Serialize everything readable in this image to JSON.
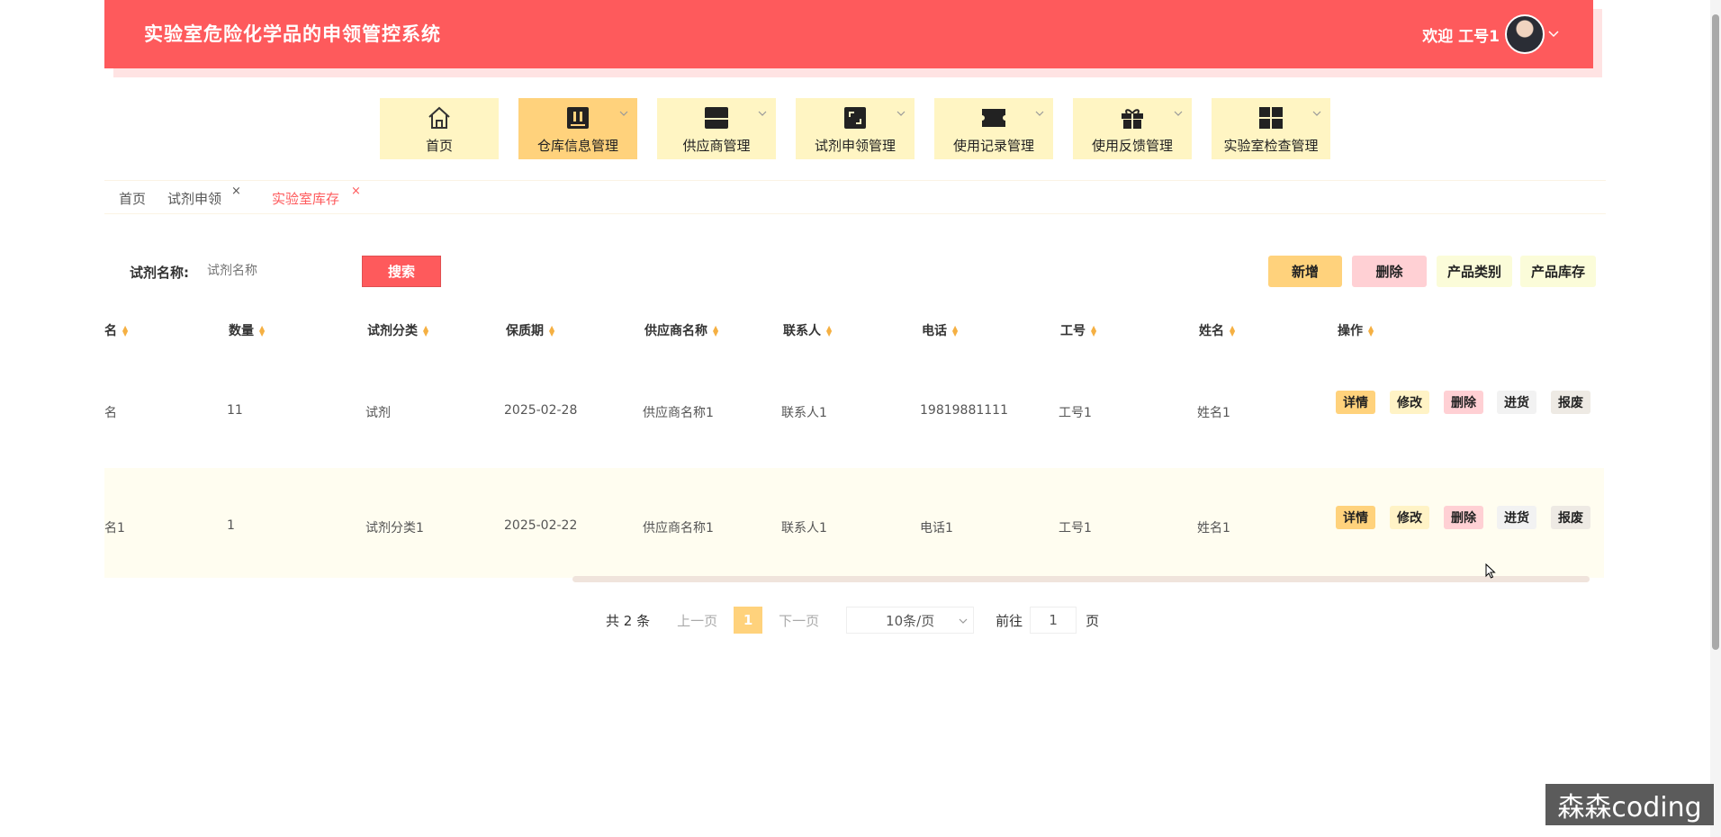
{
  "header": {
    "title": "实验室危险化学品的申领管控系统",
    "welcome": "欢迎 工号1"
  },
  "nav": [
    {
      "label": "首页",
      "icon": "home-icon"
    },
    {
      "label": "仓库信息管理",
      "icon": "warehouse-icon",
      "active": true
    },
    {
      "label": "供应商管理",
      "icon": "supplier-icon"
    },
    {
      "label": "试剂申领管理",
      "icon": "reagent-apply-icon"
    },
    {
      "label": "使用记录管理",
      "icon": "ticket-icon"
    },
    {
      "label": "使用反馈管理",
      "icon": "gift-icon"
    },
    {
      "label": "实验室检查管理",
      "icon": "grid-icon"
    }
  ],
  "tabs": [
    {
      "label": "首页"
    },
    {
      "label": "试剂申领",
      "close": "×"
    },
    {
      "label": "实验室库存",
      "close": "×",
      "active": true
    }
  ],
  "search": {
    "label": "试剂名称:",
    "placeholder": "试剂名称",
    "button": "搜索"
  },
  "actions": {
    "add": "新增",
    "delete": "删除",
    "category": "产品类别",
    "stock": "产品库存"
  },
  "table": {
    "columns": [
      "名",
      "数量",
      "试剂分类",
      "保质期",
      "供应商名称",
      "联系人",
      "电话",
      "工号",
      "姓名",
      "操作"
    ],
    "rows": [
      {
        "name": "名",
        "qty": "11",
        "category": "试剂",
        "expiry": "2025-02-28",
        "supplier": "供应商名称1",
        "contact": "联系人1",
        "phone": "19819881111",
        "worker_no": "工号1",
        "person": "姓名1"
      },
      {
        "name": "名1",
        "qty": "1",
        "category": "试剂分类1",
        "expiry": "2025-02-22",
        "supplier": "供应商名称1",
        "contact": "联系人1",
        "phone": "电话1",
        "worker_no": "工号1",
        "person": "姓名1"
      }
    ],
    "row_actions": {
      "detail": "详情",
      "edit": "修改",
      "delete": "删除",
      "restock": "进货",
      "scrap": "报废"
    }
  },
  "pagination": {
    "total": "共 2 条",
    "prev": "上一页",
    "current": "1",
    "next": "下一页",
    "page_size": "10条/页",
    "goto": "前往",
    "goto_value": "1",
    "unit": "页"
  },
  "watermark": "森森coding",
  "colors": {
    "brand": "#fe5a5c",
    "accent": "#ffd27c",
    "nav_bg": "#fff5c3"
  }
}
